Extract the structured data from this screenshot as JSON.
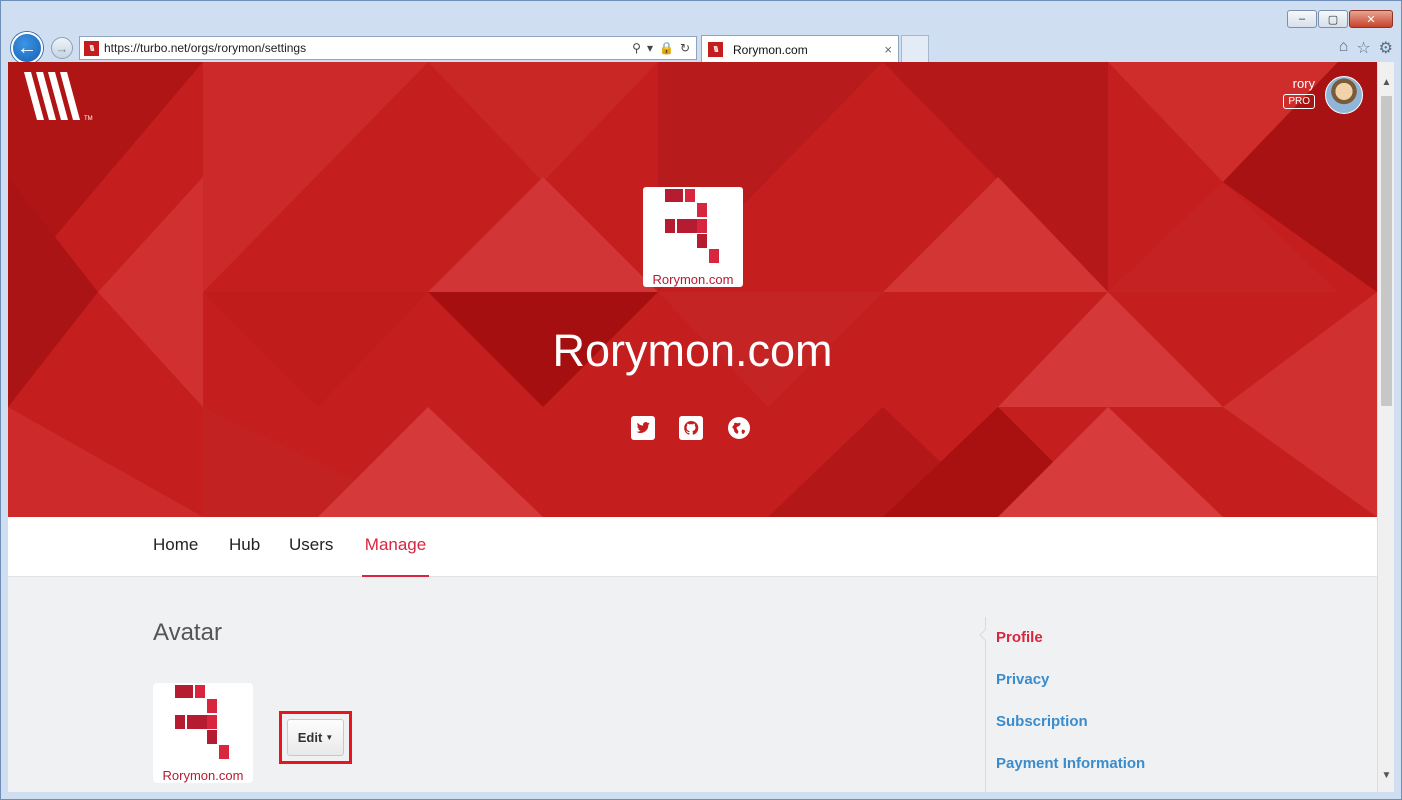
{
  "browser": {
    "url": "https://turbo.net/orgs/rorymon/settings",
    "tab_title": "Rorymon.com",
    "tab_close": "×",
    "window_buttons": [
      "–",
      "▢",
      "✕"
    ]
  },
  "header": {
    "user_name": "rory",
    "badge": "PRO"
  },
  "org": {
    "logo_text": "Rorymon.com",
    "title": "Rorymon.com",
    "socials": [
      "twitter-icon",
      "github-icon",
      "globe-icon"
    ]
  },
  "tabs": [
    {
      "label": "Home",
      "active": false
    },
    {
      "label": "Hub",
      "active": false
    },
    {
      "label": "Users",
      "active": false
    },
    {
      "label": "Manage",
      "active": true
    }
  ],
  "avatar_section": {
    "title": "Avatar",
    "logo_text": "Rorymon.com",
    "edit_label": "Edit"
  },
  "side_nav": [
    {
      "label": "Profile",
      "active": true
    },
    {
      "label": "Privacy",
      "active": false
    },
    {
      "label": "Subscription",
      "active": false
    },
    {
      "label": "Payment Information",
      "active": false
    }
  ],
  "colors": {
    "brand_red": "#c41e1e",
    "accent": "#d7263d",
    "link": "#3a8ccc",
    "highlight": "#e8141e"
  }
}
